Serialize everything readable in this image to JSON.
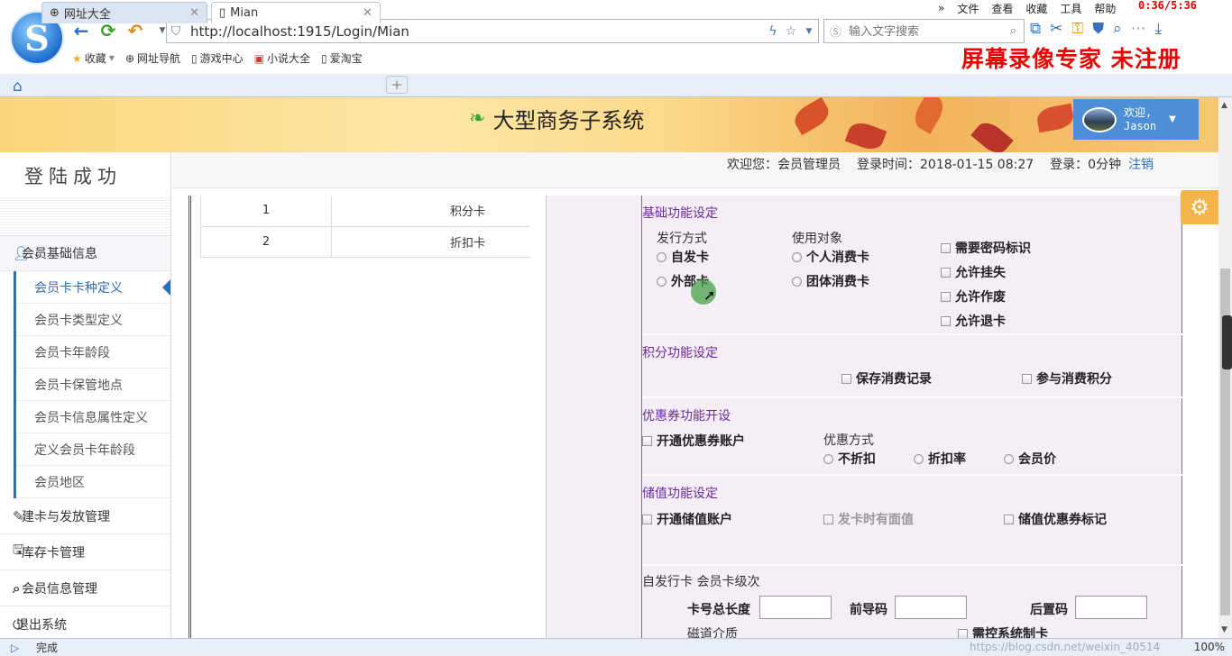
{
  "browser": {
    "menu": [
      "文件",
      "查看",
      "收藏",
      "工具",
      "帮助"
    ],
    "timer": "0:36/5:36",
    "url": "http://localhost:1915/Login/Mian",
    "search_placeholder": "输入文字搜索",
    "bookmarks": [
      "收藏",
      "网址导航",
      "游戏中心",
      "小说大全",
      "爱淘宝"
    ],
    "tabs": [
      {
        "label": "网址大全",
        "active": false
      },
      {
        "label": "Mian",
        "active": true
      }
    ],
    "status": "完成",
    "zoom": "100%",
    "status_faint": "https://blog.csdn.net/weixin_40514"
  },
  "watermark": "屏幕录像专家  未注册",
  "header": {
    "title": "大型商务子系统",
    "user_greeting": "欢迎,",
    "user_name": "Jason"
  },
  "sidebar": {
    "title": "登陆成功",
    "groups": [
      {
        "label": "会员基础信息",
        "icon": "user-icon",
        "open": true
      },
      {
        "label": "建卡与发放管理",
        "icon": "edit-icon",
        "open": false
      },
      {
        "label": "库存卡管理",
        "icon": "save-icon",
        "open": false
      },
      {
        "label": "会员信息管理",
        "icon": "search-icon",
        "open": false
      }
    ],
    "items": [
      "会员卡卡种定义",
      "会员卡类型定义",
      "会员卡年龄段",
      "会员卡保管地点",
      "会员卡信息属性定义",
      "定义会员卡年龄段",
      "会员地区"
    ],
    "active_item": "会员卡卡种定义",
    "logout": "退出系统"
  },
  "infobar": {
    "welcome": "欢迎您：会员管理员",
    "login_time": "登录时间：2018-01-15 08:27",
    "duration": "登录：0分钟",
    "logout": "注销"
  },
  "card_table": [
    {
      "id": "1",
      "name": "积分卡"
    },
    {
      "id": "2",
      "name": "折扣卡"
    }
  ],
  "form": {
    "basic": {
      "title": "基础功能设定",
      "issue_label": "发行方式",
      "issue_opts": [
        "自发卡",
        "外部卡"
      ],
      "target_label": "使用对象",
      "target_opts": [
        "个人消费卡",
        "团体消费卡"
      ],
      "checks": [
        "需要密码标识",
        "允许挂失",
        "允许作废",
        "允许退卡"
      ]
    },
    "points": {
      "title": "积分功能设定",
      "checks": [
        "保存消费记录",
        "参与消费积分"
      ]
    },
    "coupon": {
      "title": "优惠券功能开设",
      "check": "开通优惠券账户",
      "mode_label": "优惠方式",
      "mode_opts": [
        "不折扣",
        "折扣率",
        "会员价"
      ]
    },
    "stored": {
      "title": "储值功能设定",
      "checks": [
        "开通储值账户",
        "发卡时有面值",
        "储值优惠券标记"
      ],
      "disabled": [
        false,
        true,
        false
      ]
    },
    "self_issue": {
      "title": "自发行卡 会员卡级次",
      "len_label": "卡号总长度",
      "prefix_label": "前导码",
      "suffix_label": "后置码",
      "medium_label": "磁道介质",
      "ctrl_label": "需控系统制卡"
    }
  }
}
